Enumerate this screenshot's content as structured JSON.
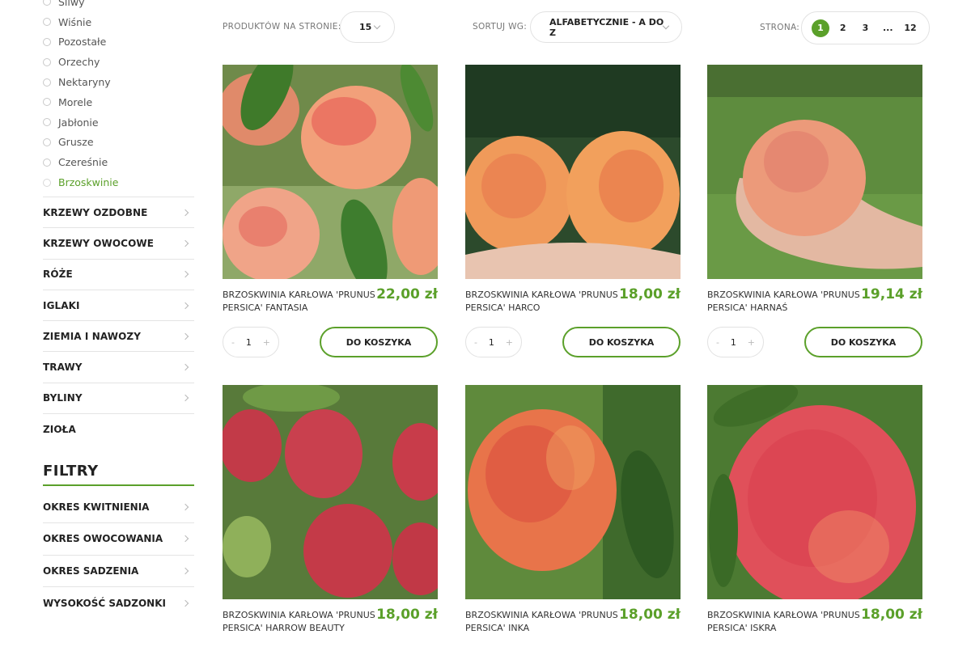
{
  "sidebar": {
    "subcategories": [
      {
        "label": "Śliwy",
        "active": false
      },
      {
        "label": "Wiśnie",
        "active": false
      },
      {
        "label": "Pozostałe",
        "active": false
      },
      {
        "label": "Orzechy",
        "active": false
      },
      {
        "label": "Nektaryny",
        "active": false
      },
      {
        "label": "Morele",
        "active": false
      },
      {
        "label": "Jabłonie",
        "active": false
      },
      {
        "label": "Grusze",
        "active": false
      },
      {
        "label": "Czereśnie",
        "active": false
      },
      {
        "label": "Brzoskwinie",
        "active": true
      }
    ],
    "categories": [
      "KRZEWY OZDOBNE",
      "KRZEWY OWOCOWE",
      "RÓŻE",
      "IGLAKI",
      "ZIEMIA I NAWOZY",
      "TRAWY",
      "BYLINY",
      "ZIOŁA"
    ],
    "filters_title": "FILTRY",
    "filters": [
      "OKRES KWITNIENIA",
      "OKRES OWOCOWANIA",
      "OKRES SADZENIA",
      "WYSOKOŚĆ SADZONKI"
    ]
  },
  "toolbar": {
    "per_page_label": "PRODUKTÓW NA STRONIE:",
    "per_page_value": "15",
    "sort_label": "SORTUJ WG:",
    "sort_value": "ALFABETYCZNIE - A DO Z",
    "page_label": "STRONA:",
    "pages": [
      "1",
      "2",
      "3",
      "...",
      "12"
    ],
    "current_page": "1"
  },
  "products": [
    {
      "name": "BRZOSKWINIA KARŁOWA 'PRUNUS PERSICA' FANTASIA",
      "price": "22,00 zł",
      "qty": "1",
      "button": "DO KOSZYKA"
    },
    {
      "name": "BRZOSKWINIA KARŁOWA 'PRUNUS PERSICA' HARCO",
      "price": "18,00 zł",
      "qty": "1",
      "button": "DO KOSZYKA"
    },
    {
      "name": "BRZOSKWINIA KARŁOWA 'PRUNUS PERSICA' HARNAŚ",
      "price": "19,14 zł",
      "qty": "1",
      "button": "DO KOSZYKA"
    },
    {
      "name": "BRZOSKWINIA KARŁOWA 'PRUNUS PERSICA' HARROW BEAUTY",
      "price": "18,00 zł",
      "qty": "1",
      "button": "DO KOSZYKA"
    },
    {
      "name": "BRZOSKWINIA KARŁOWA 'PRUNUS PERSICA' INKA",
      "price": "18,00 zł",
      "qty": "1",
      "button": "DO KOSZYKA"
    },
    {
      "name": "BRZOSKWINIA KARŁOWA 'PRUNUS PERSICA' ISKRA",
      "price": "18,00 zł",
      "qty": "1",
      "button": "DO KOSZYKA"
    }
  ],
  "qty_controls": {
    "minus": "-",
    "plus": "+"
  },
  "colors": {
    "accent": "#5ba02a",
    "border": "#e2e2e2",
    "text": "#222222"
  }
}
